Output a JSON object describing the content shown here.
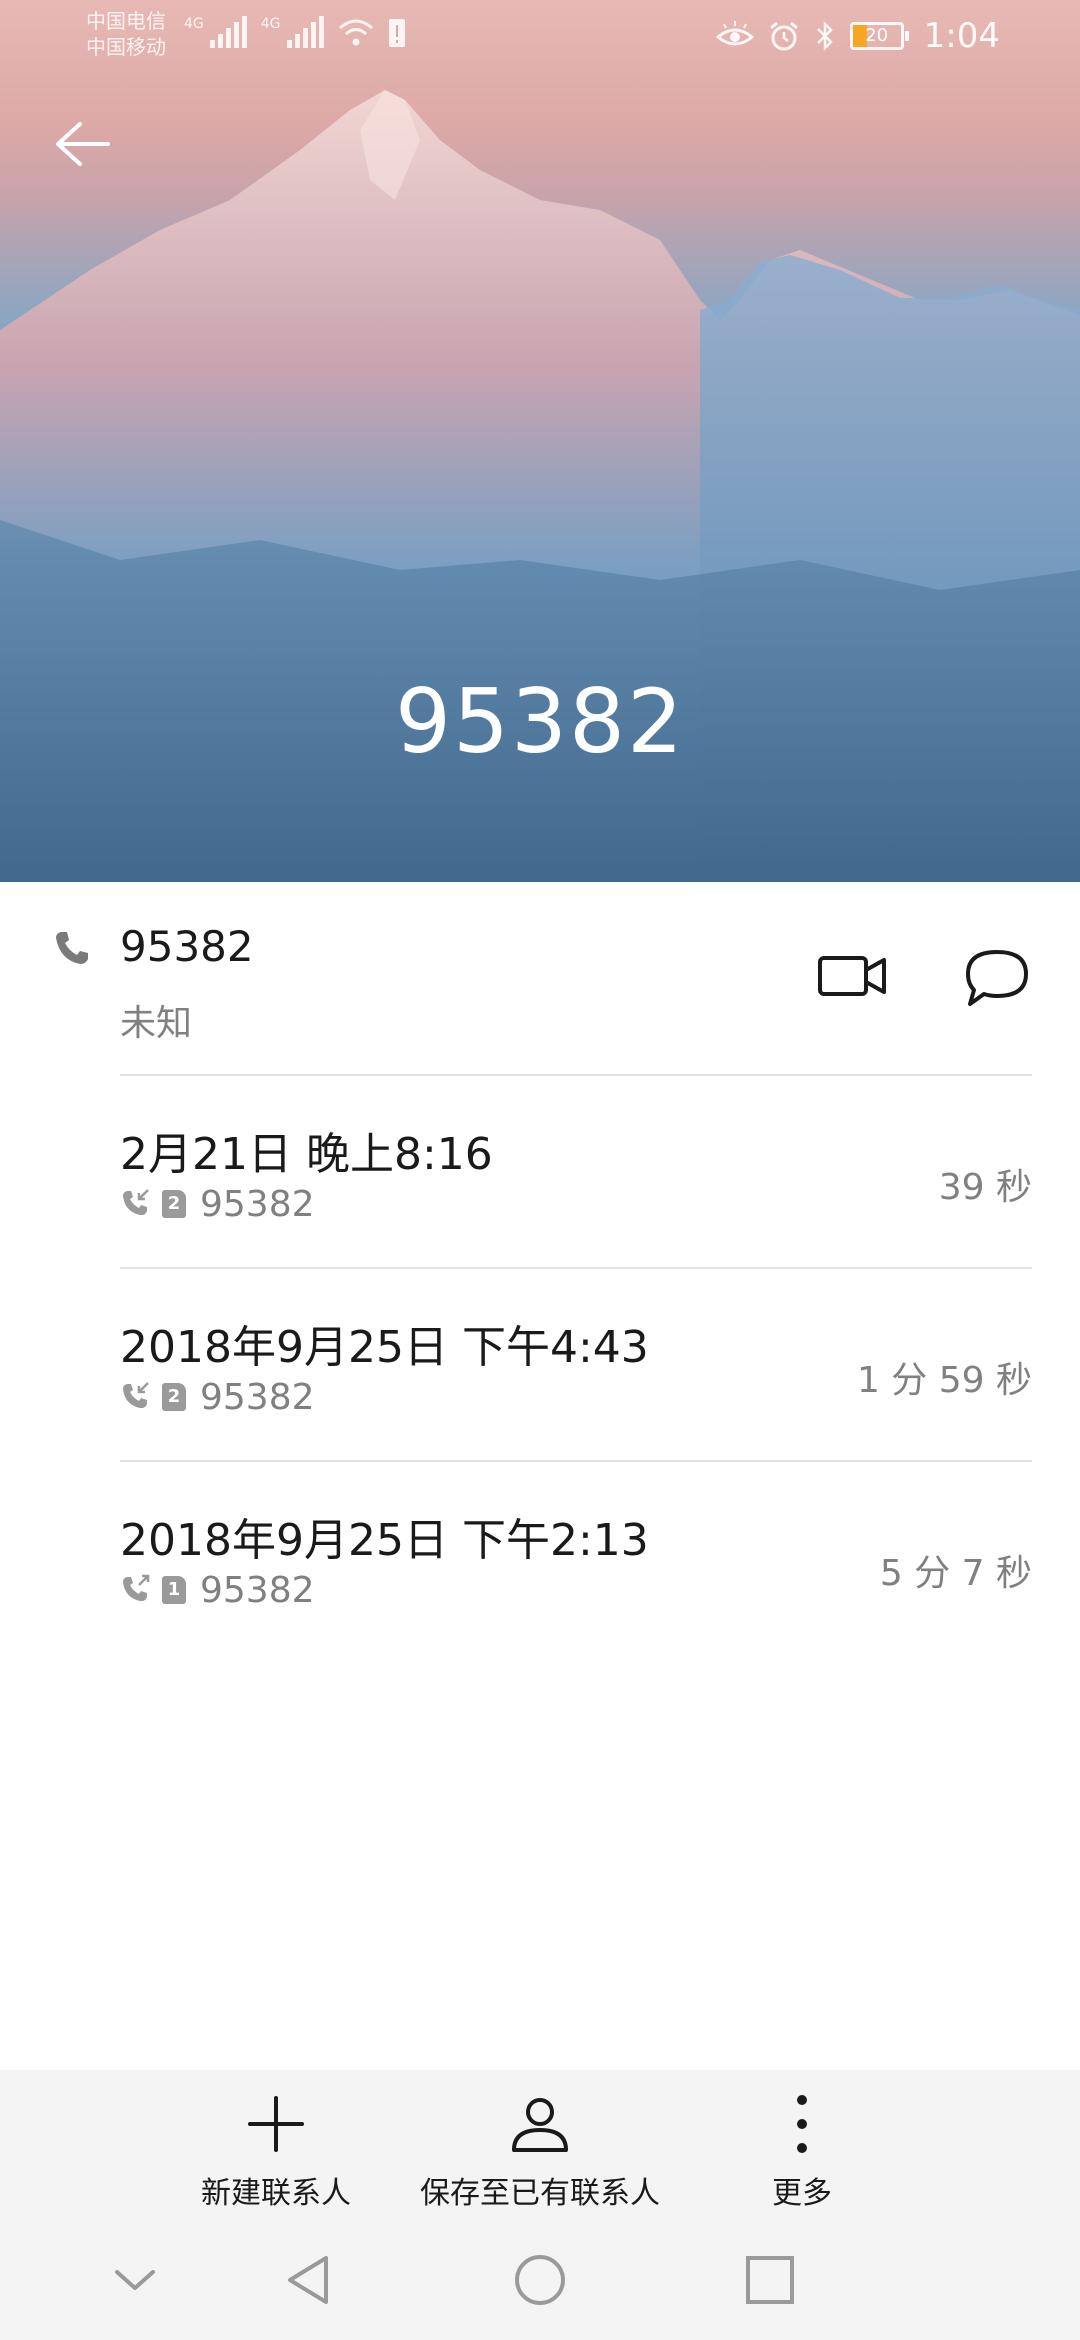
{
  "status_bar": {
    "carrier_1": "中国电信",
    "carrier_2": "中国移动",
    "network_1": "4G",
    "network_2": "4G",
    "battery": "20",
    "time": "1:04"
  },
  "header": {
    "title": "95382",
    "back_icon": "arrow-left-icon"
  },
  "contact": {
    "number": "95382",
    "label": "未知",
    "icons": [
      "phone-icon",
      "video-call-icon",
      "message-icon"
    ]
  },
  "call_log": [
    {
      "date": "2月21日 晚上8:16",
      "sim": "2",
      "number": "95382",
      "duration": "39 秒",
      "direction": "incoming"
    },
    {
      "date": "2018年9月25日 下午4:43",
      "sim": "2",
      "number": "95382",
      "duration": "1 分 59 秒",
      "direction": "incoming"
    },
    {
      "date": "2018年9月25日 下午2:13",
      "sim": "1",
      "number": "95382",
      "duration": "5 分 7 秒",
      "direction": "outgoing"
    }
  ],
  "actions": {
    "new_contact": "新建联系人",
    "save_existing": "保存至已有联系人",
    "more": "更多"
  },
  "colors": {
    "hero_top": "#e8b9b4",
    "hero_bottom": "#3f6b8d",
    "secondary_text": "#808080",
    "battery_accent": "#f5a623"
  }
}
